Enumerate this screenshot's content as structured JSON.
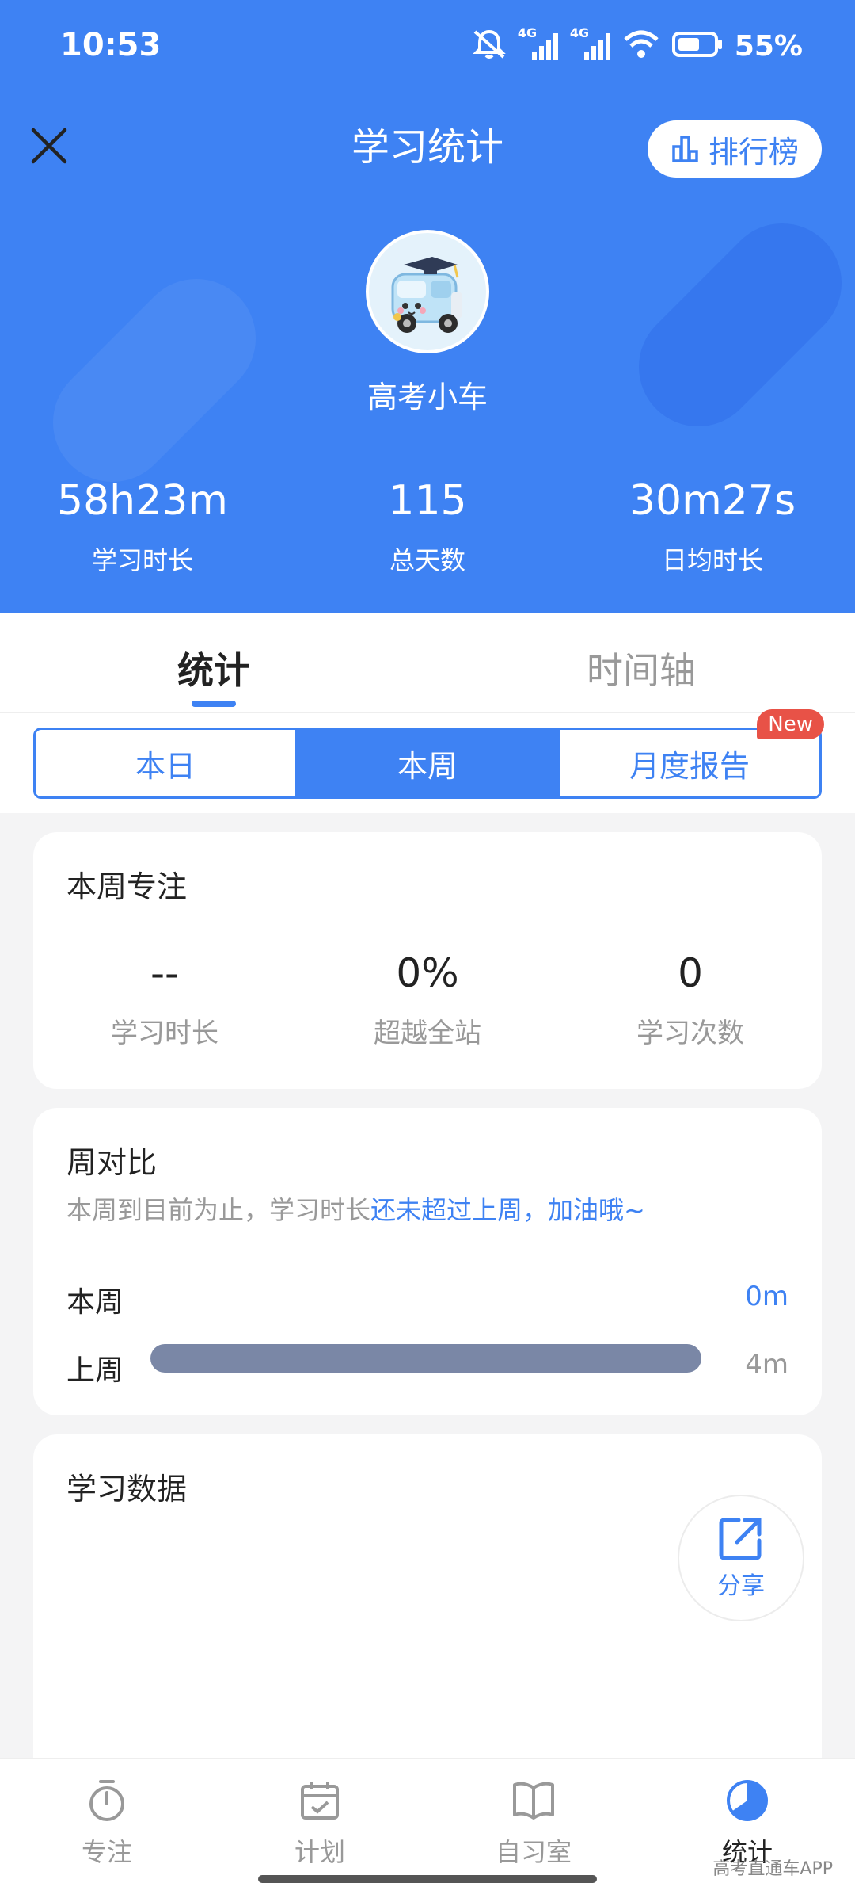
{
  "status_bar": {
    "time": "10:53",
    "net1": "4G",
    "net2": "4G",
    "battery": "55%"
  },
  "header": {
    "title": "学习统计",
    "rank_label": "排行榜",
    "username": "高考小车",
    "stats": [
      {
        "value": "58h23m",
        "label": "学习时长"
      },
      {
        "value": "115",
        "label": "总天数"
      },
      {
        "value": "30m27s",
        "label": "日均时长"
      }
    ]
  },
  "tabs": {
    "stats": "统计",
    "timeline": "时间轴"
  },
  "segments": {
    "day": "本日",
    "week": "本周",
    "month": "月度报告",
    "badge": "New"
  },
  "focus": {
    "title": "本周专注",
    "items": [
      {
        "value": "--",
        "label": "学习时长"
      },
      {
        "value": "0%",
        "label": "超越全站"
      },
      {
        "value": "0",
        "label": "学习次数"
      }
    ]
  },
  "compare": {
    "title": "周对比",
    "subtitle_plain": "本周到目前为止，学习时长",
    "subtitle_highlight": "还未超过上周，加油哦~",
    "this_week_label": "本周",
    "this_week_value": "0m",
    "this_week_fraction": 0,
    "last_week_label": "上周",
    "last_week_value": "4m",
    "last_week_fraction": 1
  },
  "study_data": {
    "title": "学习数据",
    "share_label": "分享"
  },
  "nav": {
    "focus": "专注",
    "plan": "计划",
    "room": "自习室",
    "stats": "统计"
  },
  "watermark": "高考直通车APP",
  "colors": {
    "primary": "#3e82f3",
    "bar_gray": "#7a87a6",
    "badge_red": "#e85247"
  }
}
